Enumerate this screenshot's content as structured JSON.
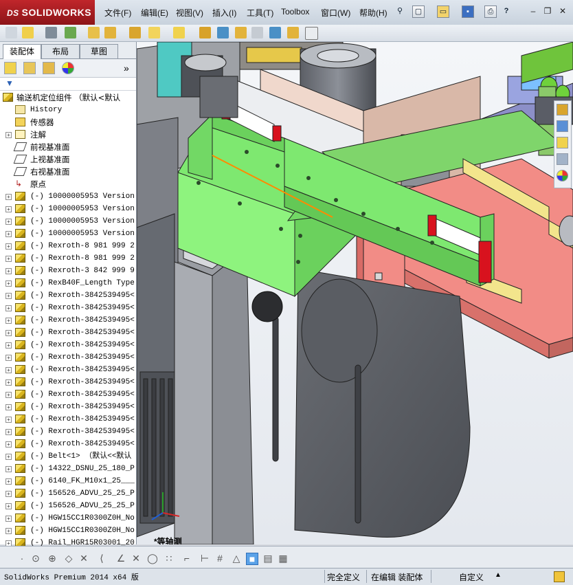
{
  "app": {
    "brand": "SOLIDWORKS",
    "brand_prefix": "DS"
  },
  "menu": [
    "文件(F)",
    "编辑(E)",
    "视图(V)",
    "插入(I)",
    "工具(T)",
    "Toolbox",
    "窗口(W)",
    "帮助(H)"
  ],
  "panel_tabs": [
    "装配体",
    "布局",
    "草图"
  ],
  "tree": {
    "root": "输送机定位组件 （默认<默认",
    "items": [
      {
        "label": "History",
        "icon": "history-icon",
        "expand": false,
        "cjk": false
      },
      {
        "label": "传感器",
        "icon": "sensor-icon",
        "expand": false,
        "cjk": true
      },
      {
        "label": "注解",
        "icon": "annotation-icon",
        "expand": true,
        "cjk": true
      },
      {
        "label": "前视基准面",
        "icon": "plane-icon",
        "expand": false,
        "cjk": true
      },
      {
        "label": "上视基准面",
        "icon": "plane-icon",
        "expand": false,
        "cjk": true
      },
      {
        "label": "右视基准面",
        "icon": "plane-icon",
        "expand": false,
        "cjk": true
      },
      {
        "label": "原点",
        "icon": "origin-icon",
        "expand": false,
        "cjk": true
      },
      {
        "label": "(-) 10000005953 Version",
        "icon": "part-icon",
        "expand": true,
        "cjk": false
      },
      {
        "label": "(-) 10000005953 Version",
        "icon": "part-icon",
        "expand": true,
        "cjk": false
      },
      {
        "label": "(-) 10000005953 Version",
        "icon": "part-icon",
        "expand": true,
        "cjk": false
      },
      {
        "label": "(-) 10000005953 Version",
        "icon": "part-icon",
        "expand": true,
        "cjk": false
      },
      {
        "label": "(-) Rexroth-8 981 999 2",
        "icon": "part-icon",
        "expand": true,
        "cjk": false
      },
      {
        "label": "(-) Rexroth-8 981 999 2",
        "icon": "part-icon",
        "expand": true,
        "cjk": false
      },
      {
        "label": "(-) Rexroth-3 842 999 9",
        "icon": "part-icon",
        "expand": true,
        "cjk": false
      },
      {
        "label": "(-) RexB40F_Length Type",
        "icon": "part-icon",
        "expand": true,
        "cjk": false
      },
      {
        "label": "(-) Rexroth-3842539495<",
        "icon": "part-icon",
        "expand": true,
        "cjk": false
      },
      {
        "label": "(-) Rexroth-3842539495<",
        "icon": "part-icon",
        "expand": true,
        "cjk": false
      },
      {
        "label": "(-) Rexroth-3842539495<",
        "icon": "part-icon",
        "expand": true,
        "cjk": false
      },
      {
        "label": "(-) Rexroth-3842539495<",
        "icon": "part-icon",
        "expand": true,
        "cjk": false
      },
      {
        "label": "(-) Rexroth-3842539495<",
        "icon": "part-icon",
        "expand": true,
        "cjk": false
      },
      {
        "label": "(-) Rexroth-3842539495<",
        "icon": "part-icon",
        "expand": true,
        "cjk": false
      },
      {
        "label": "(-) Rexroth-3842539495<",
        "icon": "part-icon",
        "expand": true,
        "cjk": false
      },
      {
        "label": "(-) Rexroth-3842539495<",
        "icon": "part-icon",
        "expand": true,
        "cjk": false
      },
      {
        "label": "(-) Rexroth-3842539495<",
        "icon": "part-icon",
        "expand": true,
        "cjk": false
      },
      {
        "label": "(-) Rexroth-3842539495<",
        "icon": "part-icon",
        "expand": true,
        "cjk": false
      },
      {
        "label": "(-) Rexroth-3842539495<",
        "icon": "part-icon",
        "expand": true,
        "cjk": false
      },
      {
        "label": "(-) Rexroth-3842539495<",
        "icon": "part-icon",
        "expand": true,
        "cjk": false
      },
      {
        "label": "(-) Rexroth-3842539495<",
        "icon": "part-icon",
        "expand": true,
        "cjk": false
      },
      {
        "label": "(-) Belt<1> （默认<<默认",
        "icon": "part-icon",
        "expand": true,
        "cjk": false
      },
      {
        "label": "(-) 14322_DSNU_25_180_P",
        "icon": "part-icon",
        "expand": true,
        "cjk": false
      },
      {
        "label": "(-) 6140_FK_M10x1_25___",
        "icon": "part-icon",
        "expand": true,
        "cjk": false
      },
      {
        "label": "(-) 156526_ADVU_25_25_P",
        "icon": "part-icon",
        "expand": true,
        "cjk": false
      },
      {
        "label": "(-) 156526_ADVU_25_25_P",
        "icon": "part-icon",
        "expand": true,
        "cjk": false
      },
      {
        "label": "(-) HGW15CC1R0300Z0H_No",
        "icon": "part-icon",
        "expand": true,
        "cjk": false
      },
      {
        "label": "(-) HGW15CC1R0300Z0H_No",
        "icon": "part-icon",
        "expand": true,
        "cjk": false
      },
      {
        "label": "(-) Rail_HGR15R03001_20",
        "icon": "part-icon",
        "expand": true,
        "cjk": false
      }
    ]
  },
  "viewport": {
    "view_label": "*等轴测"
  },
  "status": {
    "product": "SolidWorks Premium 2014 x64 版",
    "definition": "完全定义",
    "editing": "在编辑 装配体",
    "units": "自定义"
  }
}
